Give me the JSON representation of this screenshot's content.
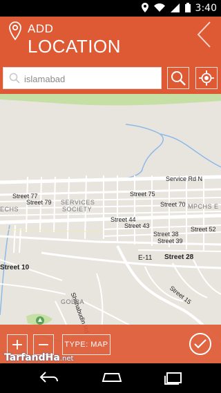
{
  "status": {
    "time": "3:40"
  },
  "header": {
    "title_small": "ADD",
    "title_big": "LOCATION"
  },
  "search": {
    "value": "islamabad"
  },
  "map": {
    "labels": {
      "service_rd_n": "Service Rd N",
      "street_77": "Street 77",
      "street_79": "Street 79",
      "echs": "ECHS",
      "services": "SERVICES",
      "society": "SOCIETY",
      "street_75": "Street 75",
      "street_70": "Street 70",
      "mpchs_e": "MPCHS E",
      "street_44": "Street 44",
      "street_43": "Street 43",
      "street_52": "Street 52",
      "street_38": "Street 38",
      "street_39": "Street 39",
      "street_10": "Street 10",
      "e_11": "E-11",
      "street_28": "Street 28",
      "shahabudin_rd": "Shahabudin Rd",
      "street_15": "Street 15",
      "golra": "GOLRA"
    }
  },
  "controls": {
    "zoom_in": "+",
    "zoom_out": "−",
    "type_label": "TYPE: MAP"
  },
  "watermark": {
    "brand": "TarfandHa",
    "suffix": ".net"
  },
  "colors": {
    "accent": "#dd5a35",
    "map_bg": "#e8e5df",
    "road": "#ffffff",
    "water": "#8db8e8",
    "park": "#c5dfa5"
  },
  "icons": [
    "location-pin-icon",
    "chevron-left-icon",
    "search-icon",
    "my-location-icon",
    "check-icon",
    "back-nav-icon",
    "home-nav-icon",
    "recents-nav-icon",
    "wifi-icon",
    "signal-icon",
    "battery-icon"
  ]
}
